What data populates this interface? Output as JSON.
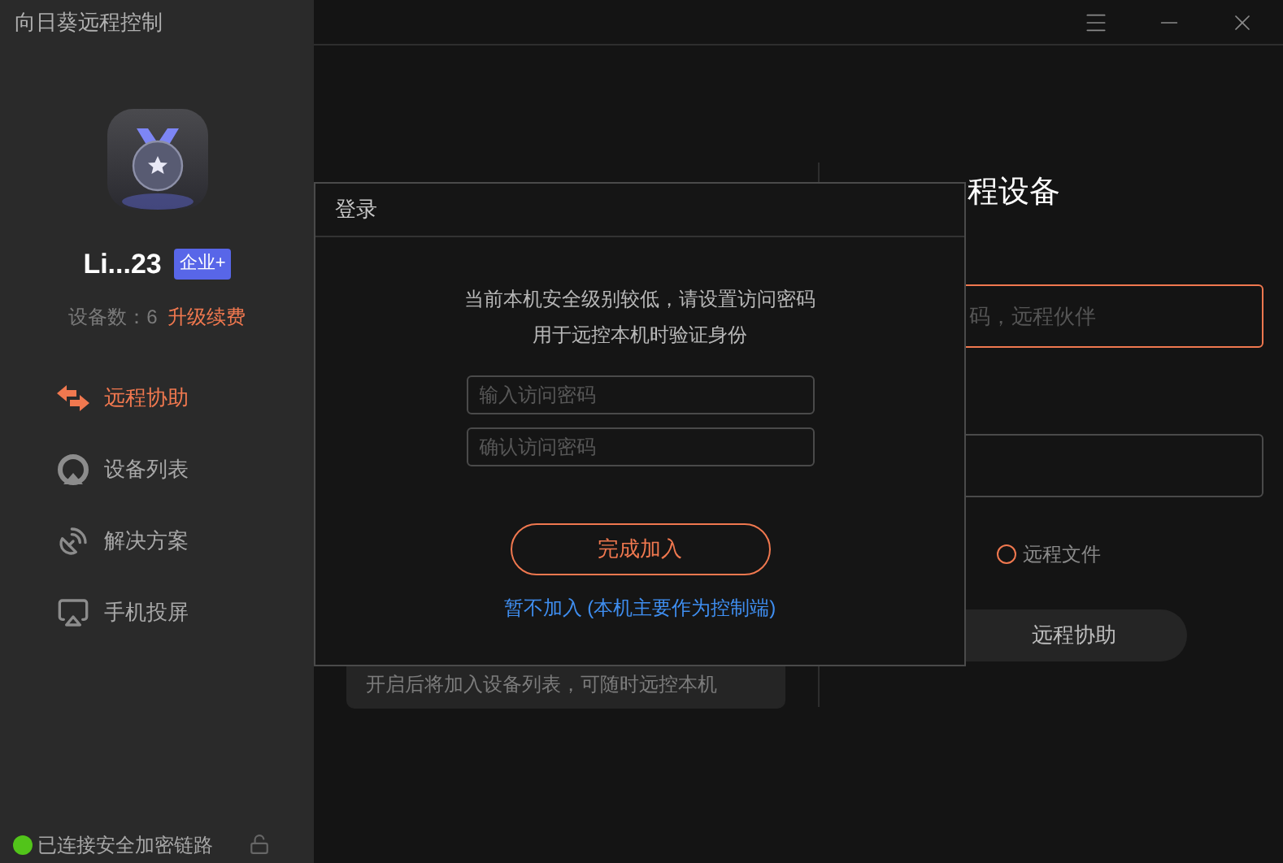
{
  "window": {
    "title": "向日葵远程控制"
  },
  "title_bar": {
    "buttons": [
      {
        "kind": "menu"
      },
      {
        "kind": "minimize"
      },
      {
        "kind": "close"
      }
    ]
  },
  "account": {
    "name": "Li...23",
    "badge": "企业+",
    "device_count": "设备数：6",
    "upgrade_link": "升级续费"
  },
  "nav": [
    {
      "kind": "remote",
      "label": "远程协助",
      "selected": true
    },
    {
      "kind": "devices",
      "label": "设备列表",
      "selected": false
    },
    {
      "kind": "solutions",
      "label": "解决方案",
      "selected": false
    },
    {
      "kind": "cast",
      "label": "手机投屏",
      "selected": false
    }
  ],
  "status": {
    "text": "已连接安全加密链路",
    "connected": true
  },
  "main": {
    "left_card_text": "开启后将加入设备列表，可随时远控本机",
    "right": {
      "title": "程设备",
      "code_field": {
        "placeholder": "码，远程伙伴"
      },
      "file_option": {
        "label": "远程文件",
        "selected": false
      },
      "assist_button": "远程协助"
    }
  },
  "dialog": {
    "title": "登录",
    "message_lines": [
      "当前本机安全级别较低，请设置访问密码",
      "用于远控本机时验证身份"
    ],
    "password_field": {
      "placeholder": "输入访问密码"
    },
    "confirm_field": {
      "placeholder": "确认访问密码"
    },
    "confirm_button": "完成加入",
    "skip_link": "暂不加入 (本机主要作为控制端)"
  }
}
